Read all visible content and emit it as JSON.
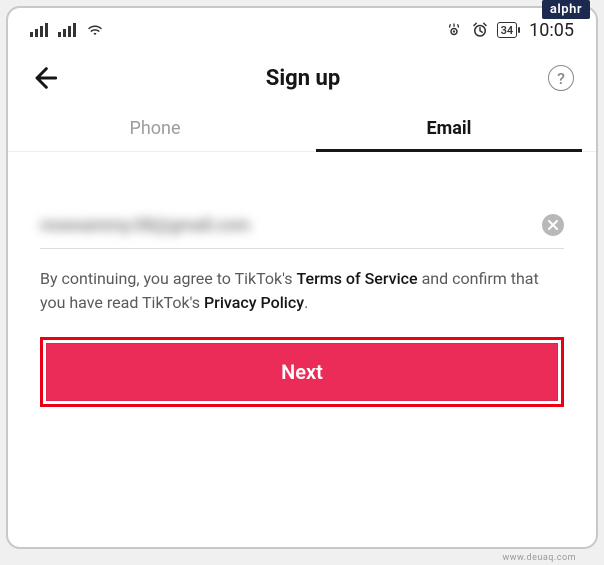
{
  "watermark": {
    "badge": "alphr",
    "footer": "www.deuaq.com"
  },
  "status_bar": {
    "battery": "34",
    "time": "10:05"
  },
  "header": {
    "title": "Sign up"
  },
  "tabs": {
    "phone": "Phone",
    "email": "Email",
    "active": "email"
  },
  "form": {
    "email_value_obscured": "rosesammy.08@gmail.com",
    "legal_prefix": "By continuing, you agree to TikTok's ",
    "terms_label": "Terms of Service",
    "legal_mid": " and confirm that you have read TikTok's ",
    "privacy_label": "Privacy Policy",
    "legal_suffix": ".",
    "next_label": "Next"
  }
}
